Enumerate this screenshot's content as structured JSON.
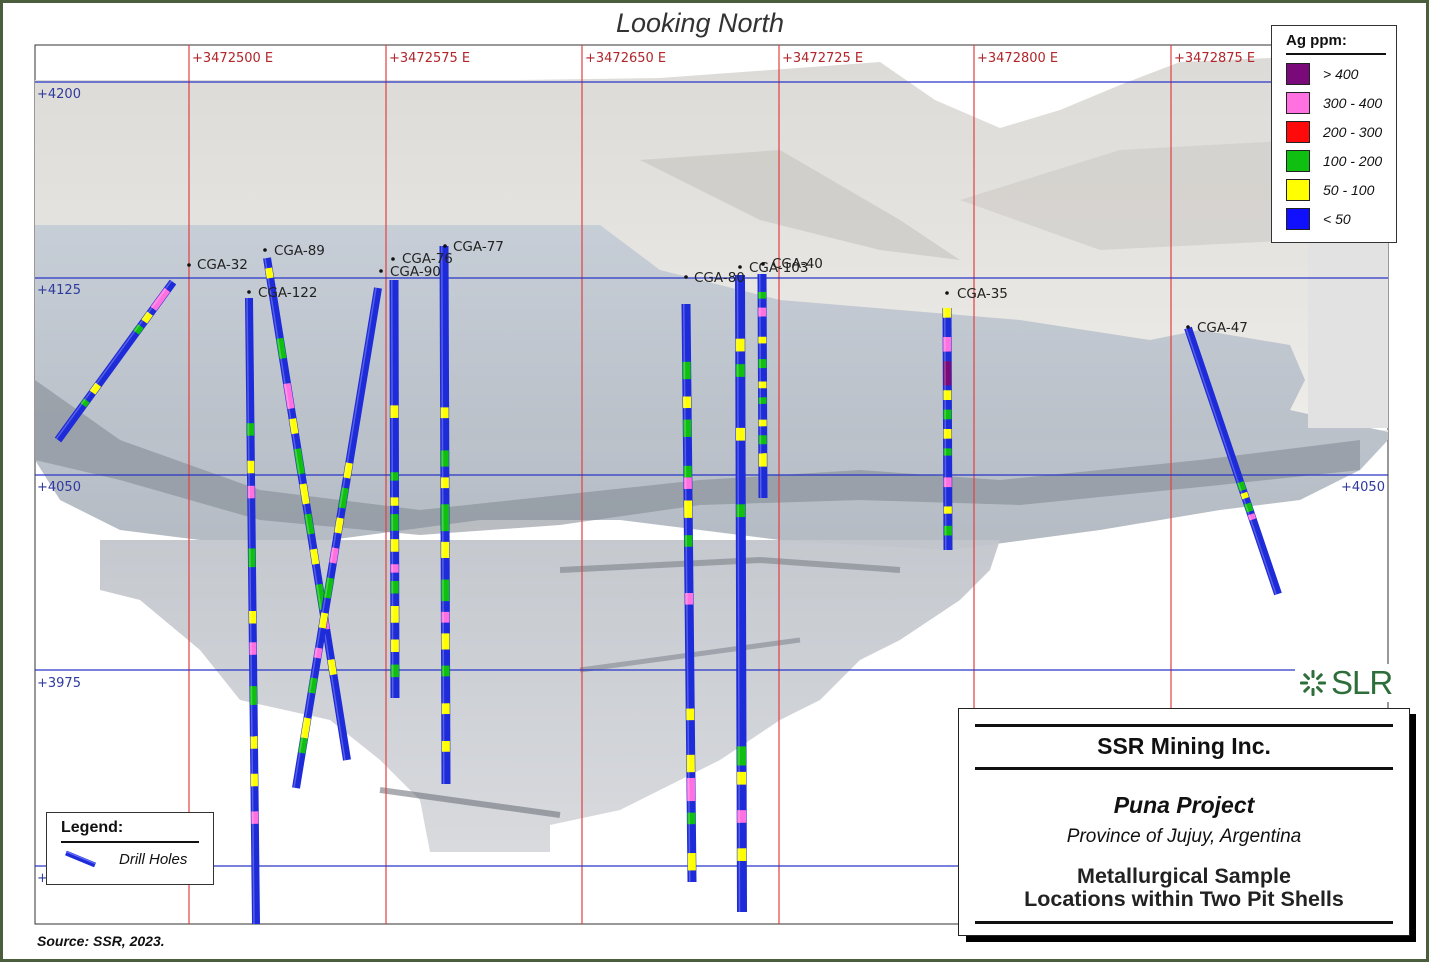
{
  "view_title": "Looking North",
  "easting_labels": [
    "+3472500 E",
    "+3472575 E",
    "+3472650 E",
    "+3472725 E",
    "+3472800 E",
    "+3472875 E"
  ],
  "elevation_labels": [
    "+4200",
    "+4125",
    "+4050",
    "+3975",
    "+"
  ],
  "elevation_label_right": "+4050",
  "drill_holes": [
    {
      "name": "CGA-32"
    },
    {
      "name": "CGA-89"
    },
    {
      "name": "CGA-122"
    },
    {
      "name": "CGA-76"
    },
    {
      "name": "CGA-90"
    },
    {
      "name": "CGA-77"
    },
    {
      "name": "CGA-80"
    },
    {
      "name": "CGA-103"
    },
    {
      "name": "CGA-40"
    },
    {
      "name": "CGA-35"
    },
    {
      "name": "CGA-47"
    }
  ],
  "ag_legend": {
    "title": "Ag ppm:",
    "items": [
      {
        "label": "> 400",
        "color": "#7a0a7a"
      },
      {
        "label": "300 - 400",
        "color": "#ff70e0"
      },
      {
        "label": "200 - 300",
        "color": "#ff0a0a"
      },
      {
        "label": "100 - 200",
        "color": "#10c010"
      },
      {
        "label": "50 - 100",
        "color": "#ffff00"
      },
      {
        "label": "< 50",
        "color": "#1010ff"
      }
    ]
  },
  "legend": {
    "title": "Legend:",
    "drill_holes_label": "Drill Holes"
  },
  "logo": {
    "text": "SLR"
  },
  "title_block": {
    "company": "SSR Mining Inc.",
    "project": "Puna Project",
    "province": "Province of Jujuy, Argentina",
    "figure_title_line1": "Metallurgical Sample",
    "figure_title_line2": "Locations within Two Pit Shells"
  },
  "source": "Source:  SSR, 2023.",
  "colors": {
    "grid_easting": "#e04040",
    "grid_elevation": "#2a36c8",
    "frame": "#4a5e3e",
    "drill_hole": "#1e2bd8"
  }
}
